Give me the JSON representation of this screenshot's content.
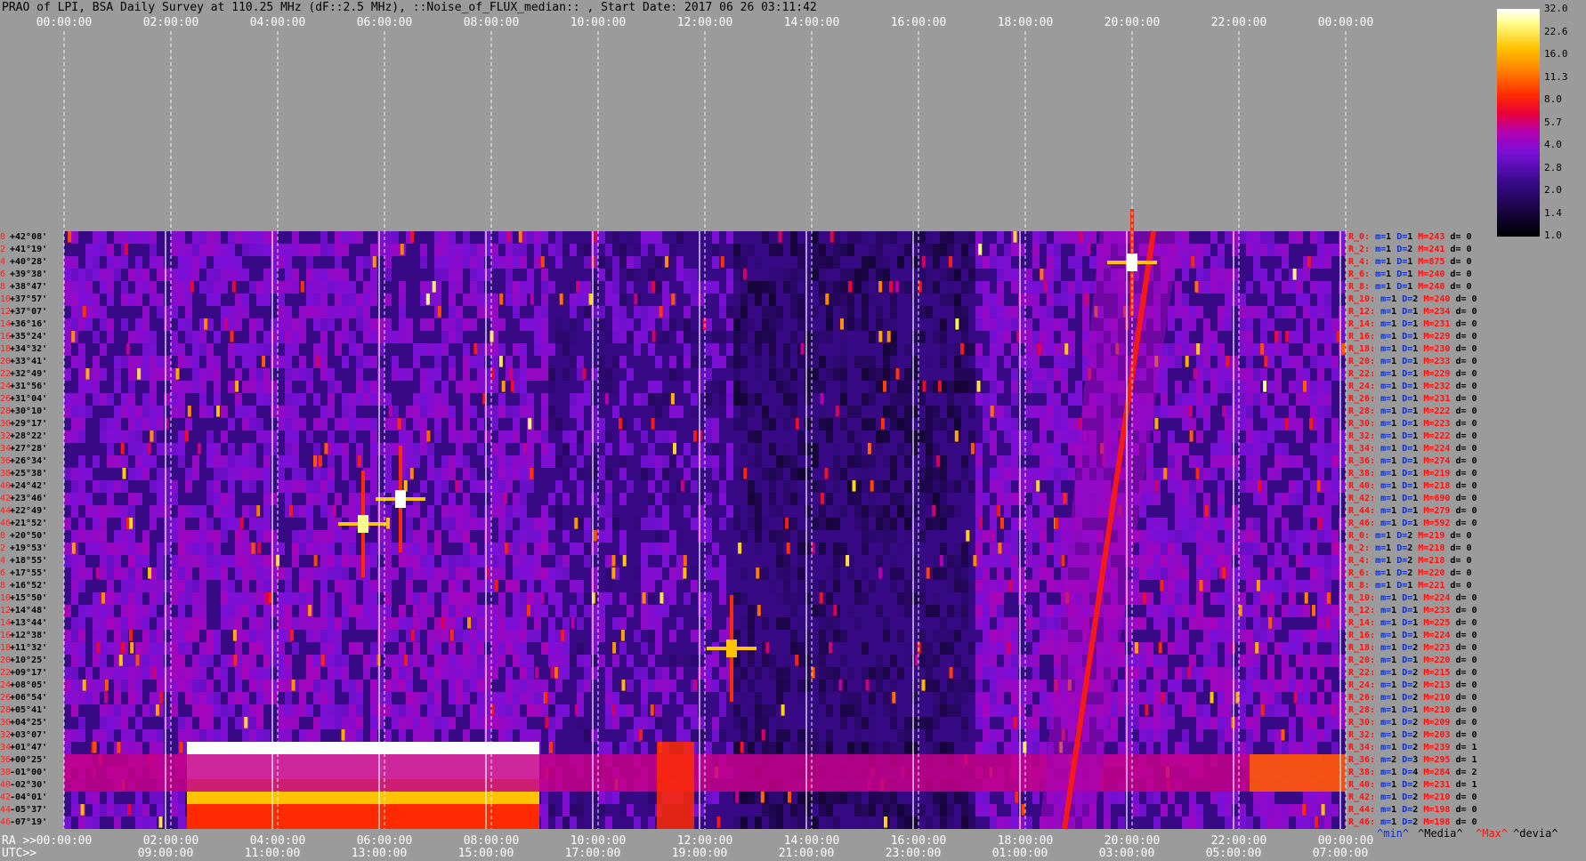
{
  "title": "PRAO of LPI, BSA Daily Survey at 110.25 MHz (dF::2.5 MHz), ::Noise_of_FLUX_median:: , Start Date: 2017 06 26 03:11:42",
  "top_ticks": [
    "00:00:00",
    "02:00:00",
    "04:00:00",
    "06:00:00",
    "08:00:00",
    "10:00:00",
    "12:00:00",
    "14:00:00",
    "16:00:00",
    "18:00:00",
    "20:00:00",
    "22:00:00",
    "00:00:00"
  ],
  "bottom_ra_prefix": "RA >>",
  "bottom_utc_prefix": "UTC>>",
  "bottom_ra_ticks": [
    "00:00:00",
    "02:00:00",
    "04:00:00",
    "06:00:00",
    "08:00:00",
    "10:00:00",
    "12:00:00",
    "14:00:00",
    "16:00:00",
    "18:00:00",
    "20:00:00",
    "22:00:00",
    "00:00:00"
  ],
  "bottom_utc_ticks": [
    "05:00:00",
    "07:00:00",
    "09:00:00",
    "11:00:00",
    "13:00:00",
    "15:00:00",
    "17:00:00",
    "19:00:00",
    "21:00:00",
    "23:00:00",
    "01:00:00",
    "03:00:00"
  ],
  "legend_keys": {
    "min": "^min^",
    "media": "^Media^",
    "max": "^Max^",
    "devia": "^devia^"
  },
  "colorbar": {
    "ticks": [
      "32.0",
      "22.6",
      "16.0",
      "11.3",
      "8.0",
      "5.7",
      "4.0",
      "2.8",
      "2.0",
      "1.4",
      "1.0"
    ]
  },
  "dec_rows": [
    {
      "idx": "0",
      "dec": "+42°08'"
    },
    {
      "idx": "2",
      "dec": "+41°19'"
    },
    {
      "idx": "4",
      "dec": "+40°28'"
    },
    {
      "idx": "6",
      "dec": "+39°38'"
    },
    {
      "idx": "8",
      "dec": "+38°47'"
    },
    {
      "idx": "10",
      "dec": "+37°57'"
    },
    {
      "idx": "12",
      "dec": "+37°07'"
    },
    {
      "idx": "14",
      "dec": "+36°16'"
    },
    {
      "idx": "16",
      "dec": "+35°24'"
    },
    {
      "idx": "18",
      "dec": "+34°32'"
    },
    {
      "idx": "20",
      "dec": "+33°41'"
    },
    {
      "idx": "22",
      "dec": "+32°49'"
    },
    {
      "idx": "24",
      "dec": "+31°56'"
    },
    {
      "idx": "26",
      "dec": "+31°04'"
    },
    {
      "idx": "28",
      "dec": "+30°10'"
    },
    {
      "idx": "30",
      "dec": "+29°17'"
    },
    {
      "idx": "32",
      "dec": "+28°22'"
    },
    {
      "idx": "34",
      "dec": "+27°28'"
    },
    {
      "idx": "36",
      "dec": "+26°34'"
    },
    {
      "idx": "38",
      "dec": "+25°38'"
    },
    {
      "idx": "40",
      "dec": "+24°42'"
    },
    {
      "idx": "42",
      "dec": "+23°46'"
    },
    {
      "idx": "44",
      "dec": "+22°49'"
    },
    {
      "idx": "46",
      "dec": "+21°52'"
    },
    {
      "idx": "0",
      "dec": "+20°50'"
    },
    {
      "idx": "2",
      "dec": "+19°53'"
    },
    {
      "idx": "4",
      "dec": "+18°55'"
    },
    {
      "idx": "6",
      "dec": "+17°55'"
    },
    {
      "idx": "8",
      "dec": "+16°52'"
    },
    {
      "idx": "10",
      "dec": "+15°50'"
    },
    {
      "idx": "12",
      "dec": "+14°48'"
    },
    {
      "idx": "14",
      "dec": "+13°44'"
    },
    {
      "idx": "16",
      "dec": "+12°38'"
    },
    {
      "idx": "18",
      "dec": "+11°32'"
    },
    {
      "idx": "20",
      "dec": "+10°25'"
    },
    {
      "idx": "22",
      "dec": "+09°17'"
    },
    {
      "idx": "24",
      "dec": "+08°05'"
    },
    {
      "idx": "26",
      "dec": "+06°54'"
    },
    {
      "idx": "28",
      "dec": "+05°41'"
    },
    {
      "idx": "30",
      "dec": "+04°25'"
    },
    {
      "idx": "32",
      "dec": "+03°07'"
    },
    {
      "idx": "34",
      "dec": "+01°47'"
    },
    {
      "idx": "36",
      "dec": "+00°25'"
    },
    {
      "idx": "38",
      "dec": "-01°00'"
    },
    {
      "idx": "40",
      "dec": "-02°30'"
    },
    {
      "idx": "42",
      "dec": "-04°01'"
    },
    {
      "idx": "44",
      "dec": "-05°37'"
    },
    {
      "idx": "46",
      "dec": "-07°19'"
    }
  ],
  "receivers": [
    {
      "r": "R_0:",
      "m": "1",
      "D": "1",
      "M": "243",
      "d": "0"
    },
    {
      "r": "R_2:",
      "m": "1",
      "D": "2",
      "M": "241",
      "d": "0"
    },
    {
      "r": "R_4:",
      "m": "1",
      "D": "1",
      "M": "875",
      "d": "0"
    },
    {
      "r": "R_6:",
      "m": "1",
      "D": "1",
      "M": "240",
      "d": "0"
    },
    {
      "r": "R_8:",
      "m": "1",
      "D": "1",
      "M": "240",
      "d": "0"
    },
    {
      "r": "R_10:",
      "m": "1",
      "D": "2",
      "M": "240",
      "d": "0"
    },
    {
      "r": "R_12:",
      "m": "1",
      "D": "1",
      "M": "234",
      "d": "0"
    },
    {
      "r": "R_14:",
      "m": "1",
      "D": "1",
      "M": "231",
      "d": "0"
    },
    {
      "r": "R_16:",
      "m": "1",
      "D": "1",
      "M": "229",
      "d": "0"
    },
    {
      "r": "R_18:",
      "m": "1",
      "D": "1",
      "M": "230",
      "d": "0"
    },
    {
      "r": "R_20:",
      "m": "1",
      "D": "1",
      "M": "233",
      "d": "0"
    },
    {
      "r": "R_22:",
      "m": "1",
      "D": "1",
      "M": "229",
      "d": "0"
    },
    {
      "r": "R_24:",
      "m": "1",
      "D": "1",
      "M": "232",
      "d": "0"
    },
    {
      "r": "R_26:",
      "m": "1",
      "D": "1",
      "M": "231",
      "d": "0"
    },
    {
      "r": "R_28:",
      "m": "1",
      "D": "1",
      "M": "222",
      "d": "0"
    },
    {
      "r": "R_30:",
      "m": "1",
      "D": "1",
      "M": "223",
      "d": "0"
    },
    {
      "r": "R_32:",
      "m": "1",
      "D": "1",
      "M": "222",
      "d": "0"
    },
    {
      "r": "R_34:",
      "m": "1",
      "D": "1",
      "M": "224",
      "d": "0"
    },
    {
      "r": "R_36:",
      "m": "1",
      "D": "1",
      "M": "274",
      "d": "0"
    },
    {
      "r": "R_38:",
      "m": "1",
      "D": "1",
      "M": "219",
      "d": "0"
    },
    {
      "r": "R_40:",
      "m": "1",
      "D": "1",
      "M": "218",
      "d": "0"
    },
    {
      "r": "R_42:",
      "m": "1",
      "D": "1",
      "M": "690",
      "d": "0"
    },
    {
      "r": "R_44:",
      "m": "1",
      "D": "1",
      "M": "279",
      "d": "0"
    },
    {
      "r": "R_46:",
      "m": "1",
      "D": "1",
      "M": "592",
      "d": "0"
    },
    {
      "r": "R_0:",
      "m": "1",
      "D": "2",
      "M": "219",
      "d": "0"
    },
    {
      "r": "R_2:",
      "m": "1",
      "D": "2",
      "M": "218",
      "d": "0"
    },
    {
      "r": "R_4:",
      "m": "1",
      "D": "2",
      "M": "218",
      "d": "0"
    },
    {
      "r": "R_6:",
      "m": "1",
      "D": "2",
      "M": "220",
      "d": "0"
    },
    {
      "r": "R_8:",
      "m": "1",
      "D": "1",
      "M": "221",
      "d": "0"
    },
    {
      "r": "R_10:",
      "m": "1",
      "D": "1",
      "M": "224",
      "d": "0"
    },
    {
      "r": "R_12:",
      "m": "1",
      "D": "1",
      "M": "233",
      "d": "0"
    },
    {
      "r": "R_14:",
      "m": "1",
      "D": "1",
      "M": "225",
      "d": "0"
    },
    {
      "r": "R_16:",
      "m": "1",
      "D": "1",
      "M": "224",
      "d": "0"
    },
    {
      "r": "R_18:",
      "m": "1",
      "D": "2",
      "M": "223",
      "d": "0"
    },
    {
      "r": "R_20:",
      "m": "1",
      "D": "1",
      "M": "220",
      "d": "0"
    },
    {
      "r": "R_22:",
      "m": "1",
      "D": "2",
      "M": "215",
      "d": "0"
    },
    {
      "r": "R_24:",
      "m": "1",
      "D": "2",
      "M": "213",
      "d": "0"
    },
    {
      "r": "R_26:",
      "m": "1",
      "D": "2",
      "M": "210",
      "d": "0"
    },
    {
      "r": "R_28:",
      "m": "1",
      "D": "1",
      "M": "210",
      "d": "0"
    },
    {
      "r": "R_30:",
      "m": "1",
      "D": "2",
      "M": "209",
      "d": "0"
    },
    {
      "r": "R_32:",
      "m": "1",
      "D": "2",
      "M": "203",
      "d": "0"
    },
    {
      "r": "R_34:",
      "m": "1",
      "D": "2",
      "M": "239",
      "d": "1"
    },
    {
      "r": "R_36:",
      "m": "2",
      "D": "3",
      "M": "295",
      "d": "1"
    },
    {
      "r": "R_38:",
      "m": "1",
      "D": "4",
      "M": "284",
      "d": "2"
    },
    {
      "r": "R_40:",
      "m": "1",
      "D": "2",
      "M": "231",
      "d": "1"
    },
    {
      "r": "R_42:",
      "m": "1",
      "D": "2",
      "M": "210",
      "d": "0"
    },
    {
      "r": "R_44:",
      "m": "1",
      "D": "2",
      "M": "198",
      "d": "0"
    },
    {
      "r": "R_46:",
      "m": "1",
      "D": "2",
      "M": "198",
      "d": "0"
    }
  ],
  "chart_data": {
    "type": "heatmap",
    "x_range_hours": [
      0,
      24
    ],
    "row_count": 48,
    "colormap": "black-purple-magenta-red-orange-yellow-white",
    "color_range": [
      1.0,
      32.0
    ],
    "features": [
      {
        "kind": "band",
        "ra_start_h": 2.3,
        "ra_end_h": 8.9,
        "rows_start": 41,
        "rows_end": 47,
        "level": 32.0
      },
      {
        "kind": "band",
        "ra_start_h": 0.0,
        "ra_end_h": 24.0,
        "rows_start": 42,
        "rows_end": 44,
        "level": 4.5
      },
      {
        "kind": "band",
        "ra_start_h": 22.2,
        "ra_end_h": 24.0,
        "rows_start": 42,
        "rows_end": 44,
        "level": 10.0
      },
      {
        "kind": "band",
        "ra_start_h": 11.1,
        "ra_end_h": 11.8,
        "rows_start": 41,
        "rows_end": 47,
        "level": 8.0
      },
      {
        "kind": "track",
        "ra_start_h": 18.6,
        "ra_end_h": 20.4,
        "rows_start": 47,
        "rows_end": 0,
        "level": 7.0
      },
      {
        "kind": "source",
        "ra_h": 20.0,
        "row": 2,
        "level": 32.0
      },
      {
        "kind": "source",
        "ra_h": 6.3,
        "row": 21,
        "level": 32.0
      },
      {
        "kind": "source",
        "ra_h": 5.6,
        "row": 23,
        "level": 22.6
      },
      {
        "kind": "source",
        "ra_h": 12.5,
        "row": 33,
        "level": 16.0
      }
    ]
  }
}
